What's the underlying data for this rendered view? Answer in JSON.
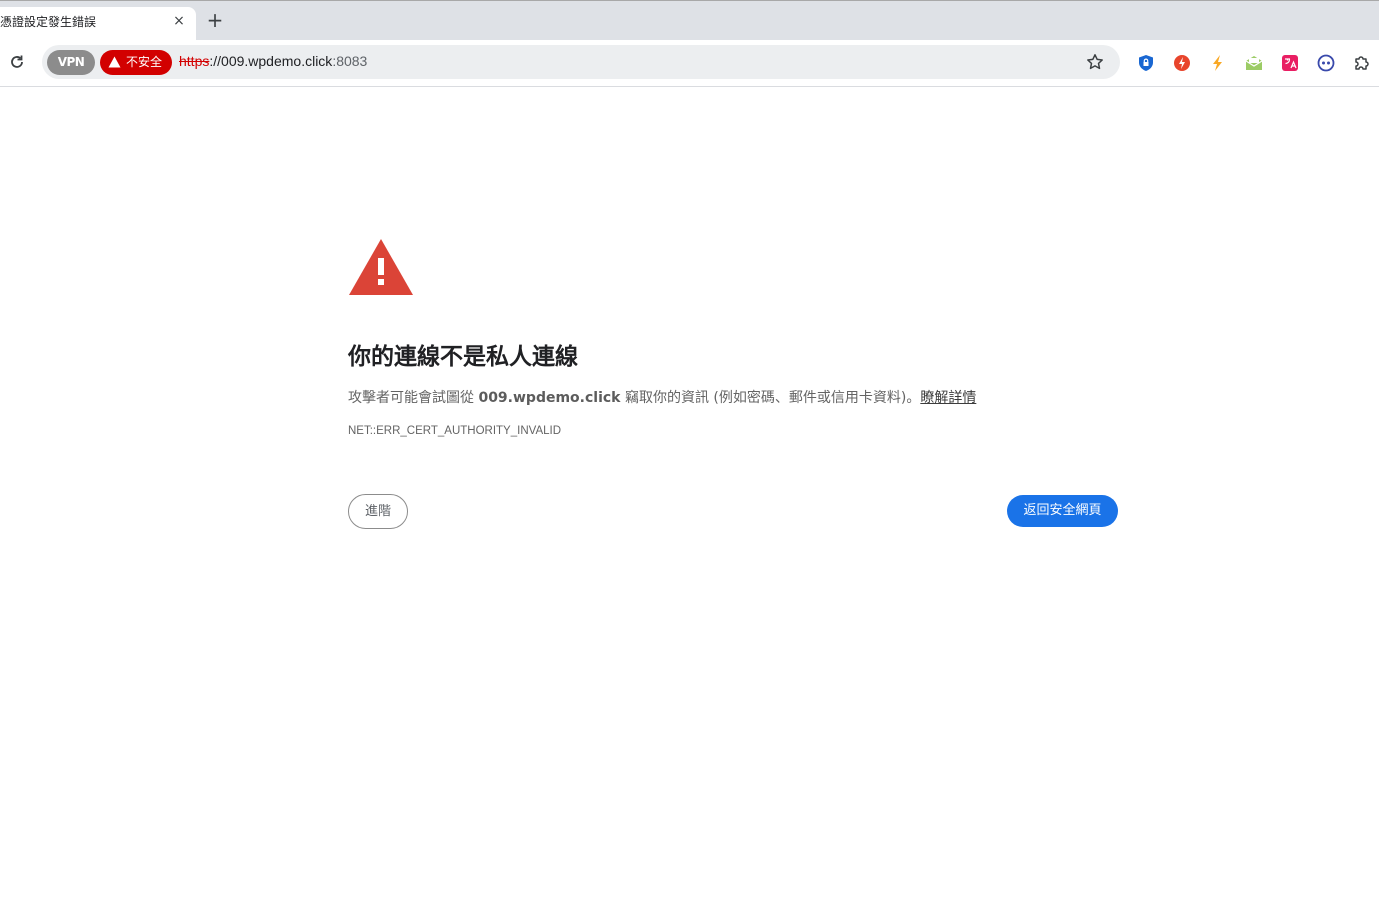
{
  "tab": {
    "title": "憑證設定發生錯誤",
    "close_glyph": "×",
    "new_tab_glyph": "+"
  },
  "toolbar": {
    "vpn_label": "VPN",
    "security_label": "不安全",
    "url_scheme": "https",
    "url_separator": "://",
    "url_host": "009.wpdemo.click",
    "url_port": ":8083",
    "extensions": [
      "shield-lock-icon",
      "flash-circle-icon",
      "lightning-icon",
      "mail-open-icon",
      "translate-icon",
      "robot-face-icon",
      "puzzle-icon"
    ]
  },
  "interstitial": {
    "heading": "你的連線不是私人連線",
    "explain_prefix": "攻擊者可能會試圖從",
    "explain_host": "009.wpdemo.click",
    "explain_suffix": "竊取你的資訊 (例如密碼、郵件或信用卡資料)。",
    "learn_more": "瞭解詳情",
    "error_code": "NET::ERR_CERT_AUTHORITY_INVALID",
    "advanced_button": "進階",
    "back_button": "返回安全網頁"
  },
  "colors": {
    "warning_red": "#db4437",
    "insecure_red": "#d20000",
    "primary_blue": "#1a73e8"
  }
}
